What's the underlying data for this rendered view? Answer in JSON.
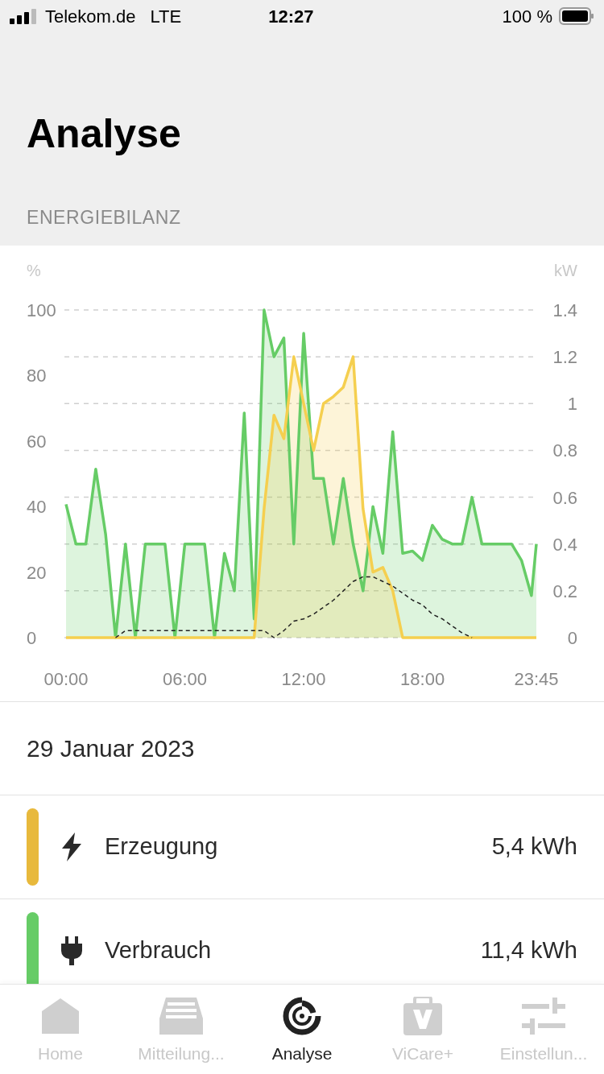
{
  "status_bar": {
    "carrier": "Telekom.de",
    "network": "LTE",
    "time": "12:27",
    "battery": "100 %"
  },
  "header": {
    "title": "Analyse",
    "section": "ENERGIEBILANZ"
  },
  "chart": {
    "left_axis": {
      "label": "%",
      "ticks": [
        "100",
        "80",
        "60",
        "40",
        "20",
        "0"
      ]
    },
    "chart_data": {
      "type": "area",
      "grid": true,
      "ylabel": "kW",
      "xlim": [
        0,
        23.75
      ],
      "ylim": [
        0,
        1.4
      ],
      "xticks": [
        {
          "value": 0,
          "label": "00:00"
        },
        {
          "value": 6,
          "label": "06:00"
        },
        {
          "value": 12,
          "label": "12:00"
        },
        {
          "value": 18,
          "label": "18:00"
        },
        {
          "value": 23.75,
          "label": "23:45"
        }
      ],
      "yticks": [
        {
          "value": 1.4,
          "label": "1.4"
        },
        {
          "value": 1.2,
          "label": "1.2"
        },
        {
          "value": 1,
          "label": "1"
        },
        {
          "value": 0.8,
          "label": "0.8"
        },
        {
          "value": 0.6,
          "label": "0.6"
        },
        {
          "value": 0.4,
          "label": "0.4"
        },
        {
          "value": 0.2,
          "label": "0.2"
        },
        {
          "value": 0,
          "label": "0"
        }
      ],
      "x": [
        0,
        0.5,
        1,
        1.5,
        2,
        2.5,
        3,
        3.5,
        4,
        4.5,
        5,
        5.5,
        6,
        6.5,
        7,
        7.5,
        8,
        8.5,
        9,
        9.5,
        10,
        10.5,
        11,
        11.5,
        12,
        12.5,
        13,
        13.5,
        14,
        14.5,
        15,
        15.5,
        16,
        16.5,
        17,
        17.5,
        18,
        18.5,
        19,
        19.5,
        20,
        20.5,
        21,
        21.5,
        22,
        22.5,
        23,
        23.5,
        23.75
      ],
      "series": [
        {
          "color": "#66cc66",
          "values": [
            0.57,
            0.4,
            0.4,
            0.72,
            0.44,
            0,
            0.4,
            0,
            0.4,
            0.4,
            0.4,
            0,
            0.4,
            0.4,
            0.4,
            0,
            0.36,
            0.2,
            0.96,
            0.08,
            1.4,
            1.2,
            1.28,
            0.4,
            1.3,
            0.68,
            0.68,
            0.4,
            0.68,
            0.4,
            0.2,
            0.56,
            0.36,
            0.88,
            0.36,
            0.37,
            0.33,
            0.48,
            0.42,
            0.4,
            0.4,
            0.6,
            0.4,
            0.4,
            0.4,
            0.4,
            0.33,
            0.18,
            0.4
          ]
        },
        {
          "color": "#f5cf4f",
          "values": [
            0,
            0,
            0,
            0,
            0,
            0,
            0,
            0,
            0,
            0,
            0,
            0,
            0,
            0,
            0,
            0,
            0,
            0,
            0,
            0,
            0.55,
            0.95,
            0.85,
            1.2,
            1,
            0.8,
            1,
            1.03,
            1.07,
            1.2,
            0.55,
            0.28,
            0.3,
            0.2,
            0,
            0,
            0,
            0,
            0,
            0,
            0,
            0,
            0,
            0,
            0,
            0,
            0,
            0,
            0
          ]
        },
        {
          "color": "#222222",
          "type": "line",
          "line_style": "dashed",
          "values": [
            null,
            null,
            null,
            null,
            null,
            0,
            0.03,
            0.03,
            0.03,
            0.03,
            0.03,
            0.03,
            0.03,
            0.03,
            0.03,
            0.03,
            0.03,
            0.03,
            0.03,
            0.03,
            0.03,
            0,
            0.03,
            0.07,
            0.08,
            0.1,
            0.13,
            0.16,
            0.2,
            0.24,
            0.26,
            0.26,
            0.24,
            0.22,
            0.19,
            0.16,
            0.14,
            0.1,
            0.08,
            0.05,
            0.02,
            0,
            null,
            null,
            null,
            null,
            null,
            null,
            null
          ]
        }
      ]
    }
  },
  "date": "29 Januar 2023",
  "summary": [
    {
      "kind": "generation",
      "label": "Erzeugung",
      "value": "5,4 kWh",
      "color": "#e8b93c"
    },
    {
      "kind": "consumption",
      "label": "Verbrauch",
      "value": "11,4 kWh",
      "color": "#66cc66"
    }
  ],
  "tabs": [
    {
      "kind": "home",
      "label": "Home",
      "selected": false
    },
    {
      "kind": "messages",
      "label": "Mitteilung...",
      "selected": false
    },
    {
      "kind": "analysis",
      "label": "Analyse",
      "selected": true
    },
    {
      "kind": "plus",
      "label": "ViCare+",
      "selected": false
    },
    {
      "kind": "settings",
      "label": "Einstellun...",
      "selected": false
    }
  ]
}
